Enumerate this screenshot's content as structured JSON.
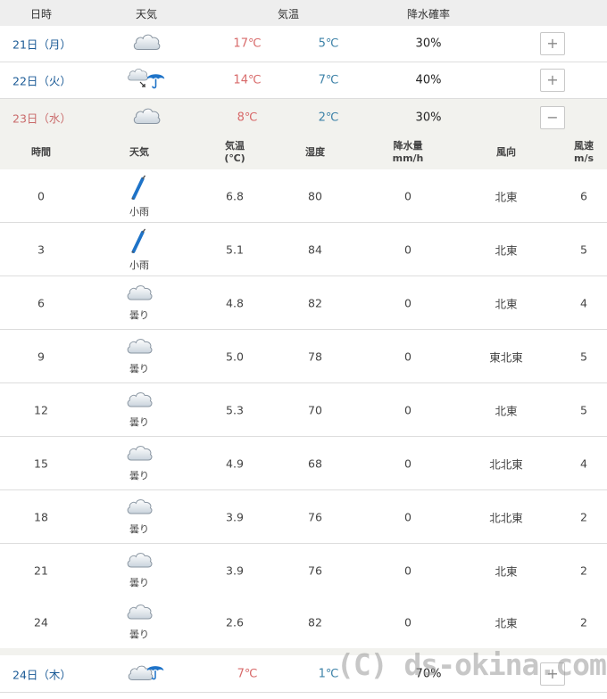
{
  "header": {
    "date": "日時",
    "weather": "天気",
    "temp": "気温",
    "precip_prob": "降水確率"
  },
  "days": [
    {
      "date": "21日（月）",
      "icon": "cloudy-icon",
      "high": "17℃",
      "low": "5℃",
      "precip": "30%",
      "toggle": "+"
    },
    {
      "date": "22日（火）",
      "icon": "cloudy-then-rain-icon",
      "high": "14℃",
      "low": "7℃",
      "precip": "40%",
      "toggle": "+"
    },
    {
      "date": "23日（水）",
      "icon": "cloudy-icon",
      "high": "8℃",
      "low": "2℃",
      "precip": "30%",
      "toggle": "−"
    },
    {
      "date": "24日（木）",
      "icon": "cloudy-rain-icon",
      "high": "7℃",
      "low": "1℃",
      "precip": "70%",
      "toggle": "+"
    }
  ],
  "hourly_header": {
    "time": "時間",
    "weather": "天気",
    "temp": "気温\n(℃)",
    "humidity": "湿度",
    "precip": "降水量\nmm/h",
    "wind_dir": "風向",
    "wind_speed": "風速\nm/s"
  },
  "hourly": [
    {
      "time": "0",
      "icon": "umbrella-icon",
      "weather": "小雨",
      "temp": "6.8",
      "humidity": "80",
      "precip": "0",
      "wind_dir": "北東",
      "wind_speed": "6"
    },
    {
      "time": "3",
      "icon": "umbrella-icon",
      "weather": "小雨",
      "temp": "5.1",
      "humidity": "84",
      "precip": "0",
      "wind_dir": "北東",
      "wind_speed": "5"
    },
    {
      "time": "6",
      "icon": "cloud-icon",
      "weather": "曇り",
      "temp": "4.8",
      "humidity": "82",
      "precip": "0",
      "wind_dir": "北東",
      "wind_speed": "4"
    },
    {
      "time": "9",
      "icon": "cloud-icon",
      "weather": "曇り",
      "temp": "5.0",
      "humidity": "78",
      "precip": "0",
      "wind_dir": "東北東",
      "wind_speed": "5"
    },
    {
      "time": "12",
      "icon": "cloud-icon",
      "weather": "曇り",
      "temp": "5.3",
      "humidity": "70",
      "precip": "0",
      "wind_dir": "北東",
      "wind_speed": "5"
    },
    {
      "time": "15",
      "icon": "cloud-icon",
      "weather": "曇り",
      "temp": "4.9",
      "humidity": "68",
      "precip": "0",
      "wind_dir": "北北東",
      "wind_speed": "4"
    },
    {
      "time": "18",
      "icon": "cloud-icon",
      "weather": "曇り",
      "temp": "3.9",
      "humidity": "76",
      "precip": "0",
      "wind_dir": "北北東",
      "wind_speed": "2"
    },
    {
      "time": "21",
      "icon": "cloud-icon",
      "weather": "曇り",
      "temp": "3.9",
      "humidity": "76",
      "precip": "0",
      "wind_dir": "北東",
      "wind_speed": "2"
    },
    {
      "time": "24",
      "icon": "cloud-icon",
      "weather": "曇り",
      "temp": "2.6",
      "humidity": "82",
      "precip": "0",
      "wind_dir": "北東",
      "wind_speed": "2"
    }
  ],
  "watermark": "(C) ds-okina.com",
  "colors": {
    "date_blue": "#1a5a96",
    "high_red": "#d86a6a",
    "low_blue": "#3d82a8",
    "expanded_bg": "#f2f2ee",
    "header_bg": "#eeeeee",
    "umbrella_blue": "#1e73c8"
  }
}
